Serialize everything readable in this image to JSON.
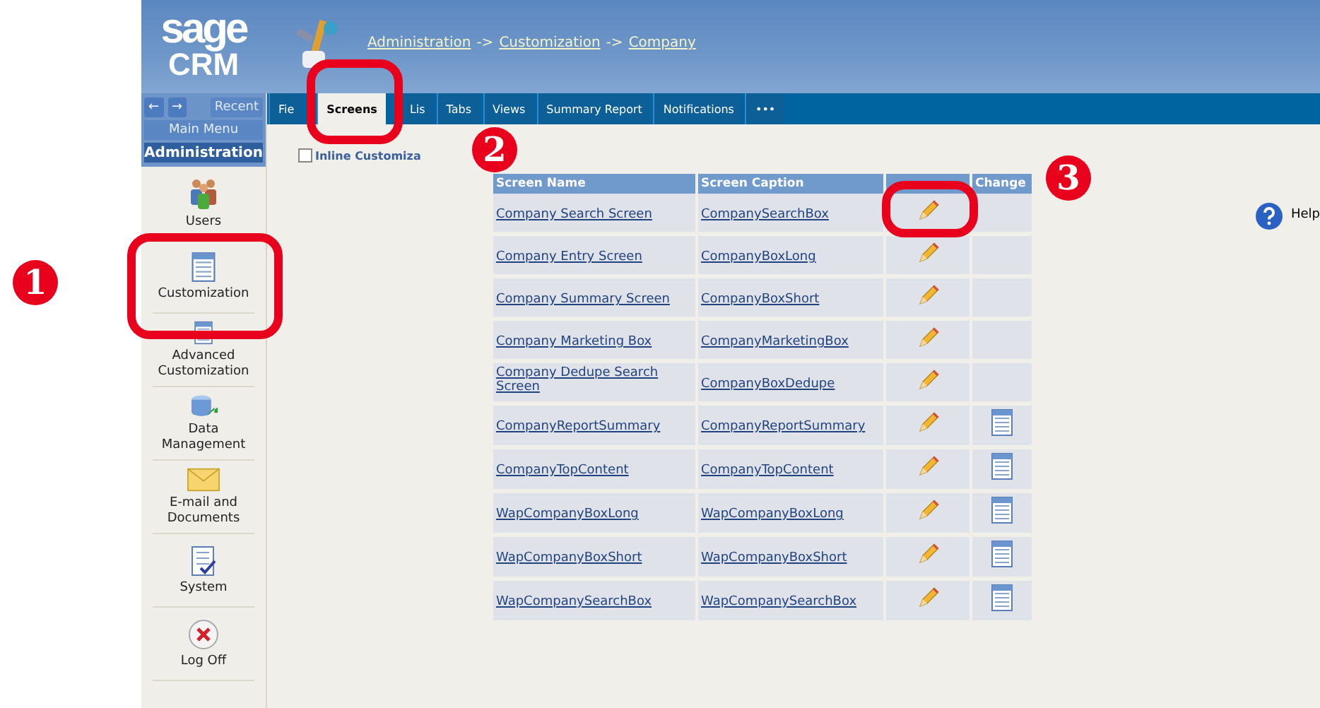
{
  "header": {
    "logo_top": "sage",
    "logo_bottom": "CRM",
    "breadcrumb": [
      {
        "label": "Administration"
      },
      {
        "label": "Customization"
      },
      {
        "label": "Company"
      }
    ],
    "separator": "->"
  },
  "nav": {
    "back": "←",
    "forward": "→",
    "recent": "Recent",
    "main_menu": "Main Menu",
    "section": "Administration"
  },
  "sidebar": {
    "items": [
      {
        "label": "Users",
        "kind": "users"
      },
      {
        "label": "Customization",
        "kind": "doc"
      },
      {
        "label": "Advanced Customization",
        "kind": "doc"
      },
      {
        "label": "Data Management",
        "kind": "database"
      },
      {
        "label": "E-mail and Documents",
        "kind": "mail"
      },
      {
        "label": "System",
        "kind": "check"
      },
      {
        "label": "Log Off",
        "kind": "logoff"
      }
    ]
  },
  "tabs": [
    {
      "label": "Fie",
      "selected": false
    },
    {
      "label": "Screens",
      "selected": true
    },
    {
      "label": "Lis",
      "selected": false
    },
    {
      "label": "Tabs",
      "selected": false
    },
    {
      "label": "Views",
      "selected": false
    },
    {
      "label": "Summary Report",
      "selected": false
    },
    {
      "label": "Notifications",
      "selected": false
    },
    {
      "label": "•••",
      "selected": false
    }
  ],
  "inline_customization": {
    "label": "Inline Customiza",
    "checked": false
  },
  "table": {
    "columns": [
      "Screen Name",
      "Screen Caption",
      "Change"
    ],
    "rows": [
      {
        "name": "Company Search Screen",
        "caption": "CompanySearchBox",
        "change_icon": false
      },
      {
        "name": "Company Entry Screen",
        "caption": "CompanyBoxLong",
        "change_icon": false
      },
      {
        "name": "Company Summary Screen",
        "caption": "CompanyBoxShort",
        "change_icon": false
      },
      {
        "name": "Company Marketing Box",
        "caption": "CompanyMarketingBox",
        "change_icon": false
      },
      {
        "name": "Company Dedupe Search Screen",
        "caption": "CompanyBoxDedupe",
        "change_icon": false
      },
      {
        "name": "CompanyReportSummary",
        "caption": "CompanyReportSummary",
        "change_icon": true
      },
      {
        "name": "CompanyTopContent",
        "caption": "CompanyTopContent",
        "change_icon": true
      },
      {
        "name": "WapCompanyBoxLong",
        "caption": "WapCompanyBoxLong",
        "change_icon": true
      },
      {
        "name": "WapCompanyBoxShort",
        "caption": "WapCompanyBoxShort",
        "change_icon": true
      },
      {
        "name": "WapCompanySearchBox",
        "caption": "WapCompanySearchBox",
        "change_icon": true
      }
    ]
  },
  "help": "Help",
  "annotations": [
    {
      "label": "1"
    },
    {
      "label": "2"
    },
    {
      "label": "3"
    }
  ]
}
